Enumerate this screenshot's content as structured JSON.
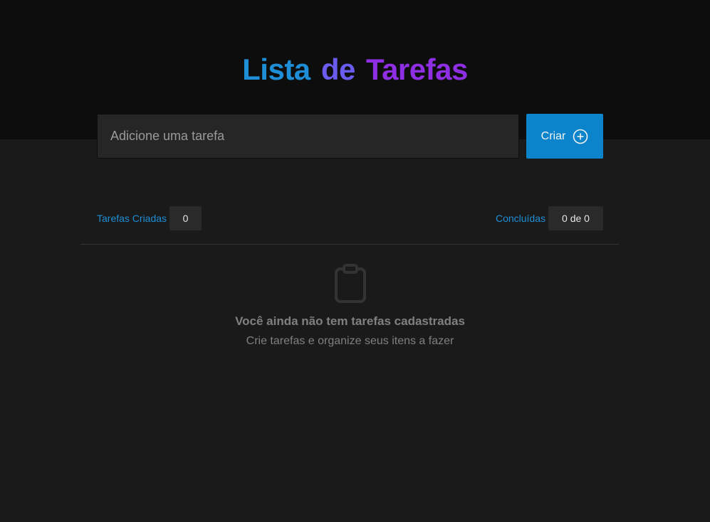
{
  "header": {
    "title_parts": [
      "Lista",
      "de",
      "Tarefas"
    ],
    "colors": {
      "word1": "#1e8fd6",
      "word2": "#6b5cf0",
      "word3": "#8e2fe3"
    }
  },
  "form": {
    "input_placeholder": "Adicione uma tarefa",
    "input_value": "",
    "create_label": "Criar",
    "create_icon": "plus-circle-icon",
    "accent": "#0b84cc"
  },
  "counters": {
    "created_label": "Tarefas Criadas",
    "created_value": "0",
    "done_label": "Concluídas",
    "done_value": "0 de 0"
  },
  "empty_state": {
    "icon": "clipboard-icon",
    "title": "Você ainda não tem tarefas cadastradas",
    "subtitle": "Crie tarefas e organize seus itens a fazer"
  }
}
